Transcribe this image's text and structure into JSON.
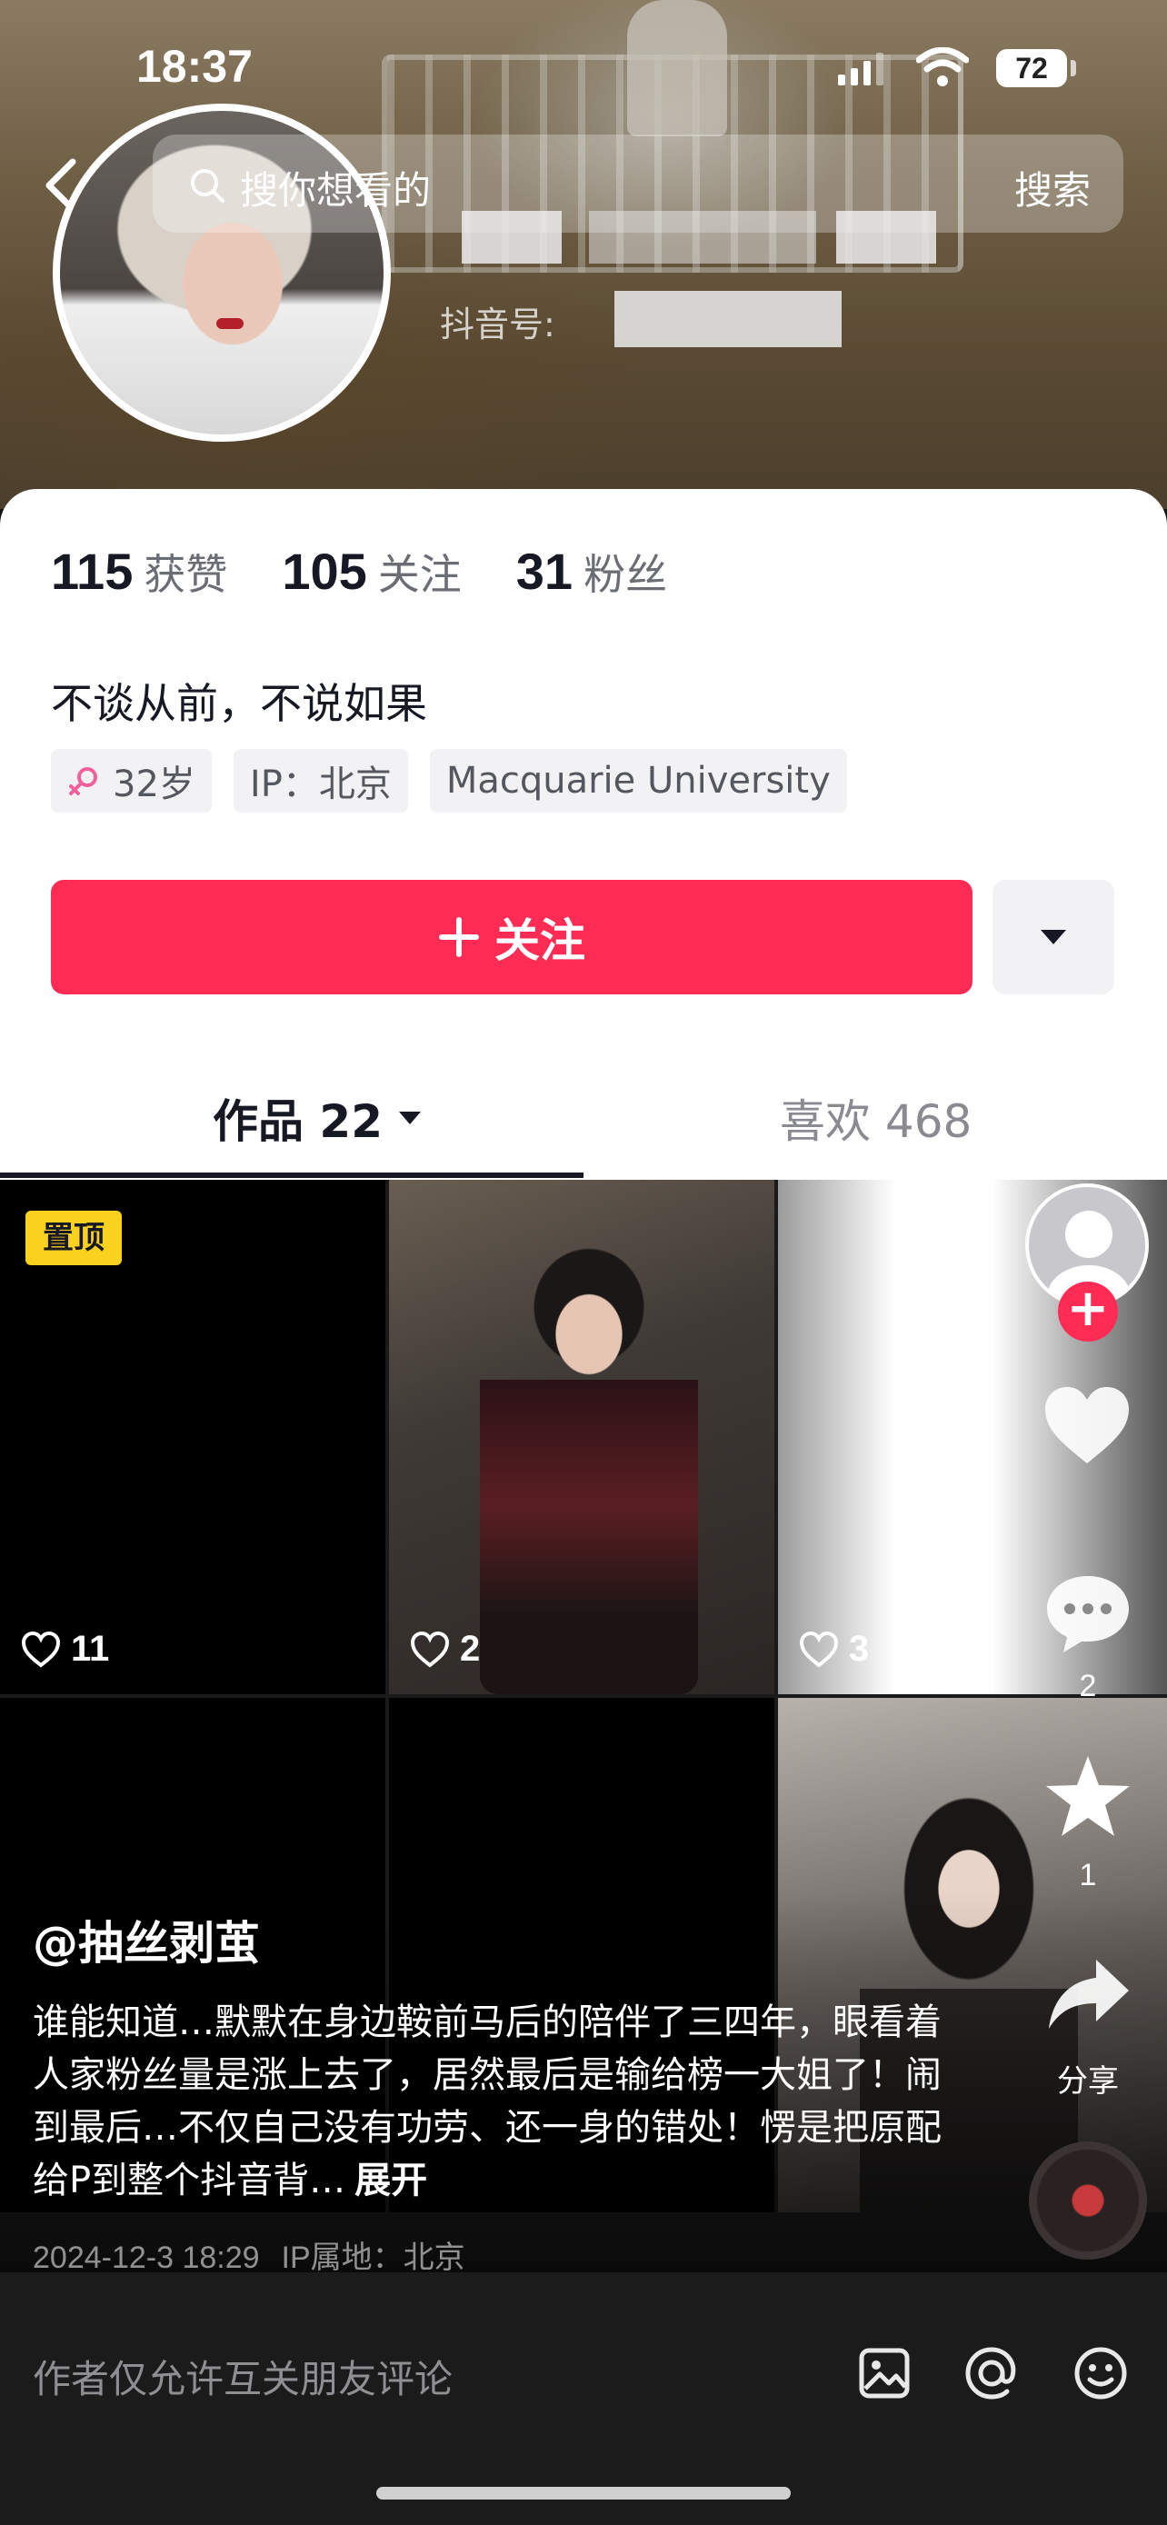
{
  "status_bar": {
    "time": "18:37",
    "battery": "72"
  },
  "search": {
    "placeholder": "搜你想看的",
    "button": "搜索"
  },
  "profile": {
    "douyin_id_label": "抖音号:",
    "stats": [
      {
        "value": "115",
        "label": "获赞"
      },
      {
        "value": "105",
        "label": "关注"
      },
      {
        "value": "31",
        "label": "粉丝"
      }
    ],
    "bio": "不谈从前，不说如果",
    "tags": {
      "age": "32岁",
      "ip": "IP：北京",
      "school": "Macquarie University"
    },
    "follow_button": "关注"
  },
  "tabs": {
    "works": "作品 22",
    "likes": "喜欢 468"
  },
  "grid": {
    "pinned_label": "置顶",
    "items": [
      {
        "likes": "11"
      },
      {
        "likes": "2"
      },
      {
        "likes": "3"
      }
    ]
  },
  "overlay": {
    "comment_count": "2",
    "favorite_count": "1",
    "share_label": "分享",
    "author": "@抽丝剥茧",
    "caption": "谁能知道…默默在身边鞍前马后的陪伴了三四年，眼看着人家粉丝量是涨上去了，居然最后是输给榜一大姐了！闹到最后…不仅自己没有功劳、还一身的错处！愣是把原配给P到整个抖音背…",
    "expand": "展开",
    "date": "2024-12-3 18:29",
    "ip_location": "IP属地：北京"
  },
  "comment_bar": {
    "placeholder": "作者仅允许互关朋友评论"
  },
  "colors": {
    "accent": "#fe2c55",
    "pinned": "#fbd11f"
  },
  "icons": [
    "back-icon",
    "search-icon",
    "female-icon",
    "plus-icon",
    "caret-down-icon",
    "heart-icon",
    "comment-icon",
    "star-icon",
    "share-icon",
    "image-icon",
    "at-icon",
    "emoji-icon"
  ]
}
